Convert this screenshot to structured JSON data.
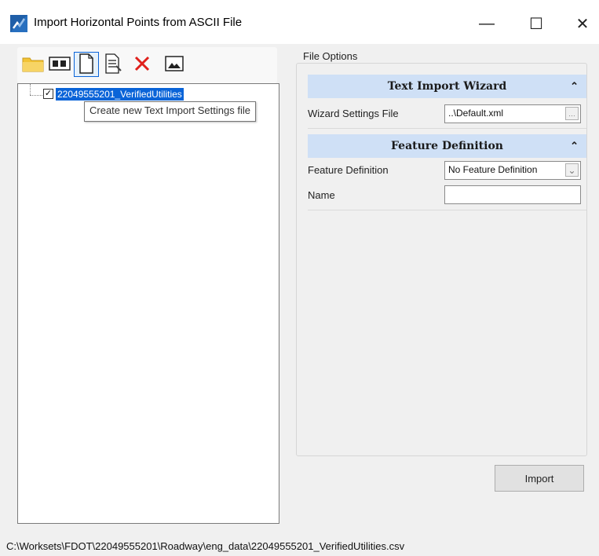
{
  "window": {
    "title": "Import Horizontal Points from ASCII File",
    "minimize_glyph": "—",
    "maximize_glyph": "☐",
    "close_glyph": "✕"
  },
  "toolbar": {
    "buttons": [
      {
        "name": "open-folder-icon",
        "tooltip": ""
      },
      {
        "name": "preview-icon",
        "tooltip": ""
      },
      {
        "name": "new-file-icon",
        "tooltip": "Create new Text Import Settings file"
      },
      {
        "name": "edit-settings-icon",
        "tooltip": ""
      },
      {
        "name": "delete-icon",
        "tooltip": ""
      },
      {
        "name": "image-icon",
        "tooltip": ""
      }
    ]
  },
  "tree": {
    "items": [
      {
        "label": "22049555201_VerifiedUtilities",
        "checked": true
      }
    ]
  },
  "tooltip": {
    "text": "Create new Text Import Settings file"
  },
  "file_options": {
    "label": "File Options",
    "text_import_wizard": {
      "title": "Text Import Wizard",
      "wizard_settings_label": "Wizard Settings File",
      "wizard_settings_value": "..\\Default.xml",
      "browse_glyph": "…"
    },
    "feature_definition": {
      "title": "Feature Definition",
      "feature_definition_label": "Feature Definition",
      "feature_definition_value": "No Feature Definition",
      "dropdown_glyph": "⌄",
      "name_label": "Name",
      "name_value": ""
    },
    "collapse_glyph": "⌃"
  },
  "import_button": {
    "label": "Import"
  },
  "status_bar": {
    "path": "C:\\Worksets\\FDOT\\22049555201\\Roadway\\eng_data\\22049555201_VerifiedUtilities.csv"
  },
  "colors": {
    "section_header": "#cfe0f6",
    "selection": "#0a64d8",
    "delete_red": "#e0201b",
    "folder_yellow": "#f2c335"
  }
}
